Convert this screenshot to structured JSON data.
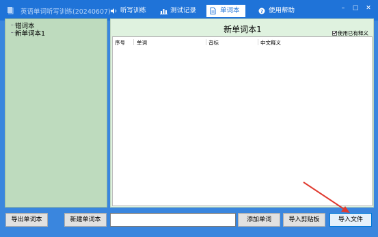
{
  "window": {
    "title": "英语单词听写训练(20240607)",
    "minimize_glyph": "–",
    "maximize_glyph": "□",
    "close_glyph": "✕"
  },
  "tabs": [
    {
      "label": "听写训练",
      "icon": "speaker-icon"
    },
    {
      "label": "测试记录",
      "icon": "bar-chart-icon"
    },
    {
      "label": "单词本",
      "icon": "document-icon",
      "active": true
    },
    {
      "label": "使用帮助",
      "icon": "help-icon"
    }
  ],
  "sidebar": {
    "items": [
      {
        "label": "错词本"
      },
      {
        "label": "新单词本1"
      }
    ]
  },
  "main": {
    "book_title": "新单词本1",
    "use_existing_definition_label": "使用已有释义",
    "use_existing_definition_checked": true,
    "columns": [
      "序号",
      "单词",
      "音标",
      "中文释义"
    ]
  },
  "toolbar": {
    "export_label": "导出单词本",
    "new_label": "新建单词本",
    "input_value": "",
    "add_word_label": "添加单词",
    "import_clipboard_label": "导入剪贴板",
    "import_file_label": "导入文件"
  },
  "colors": {
    "titlebar": "#1f73d8",
    "window_bg": "#3a86de",
    "sidebar_bg": "#bedbbe",
    "main_bg": "#dff2df",
    "annotation_arrow": "#e03a2f"
  }
}
